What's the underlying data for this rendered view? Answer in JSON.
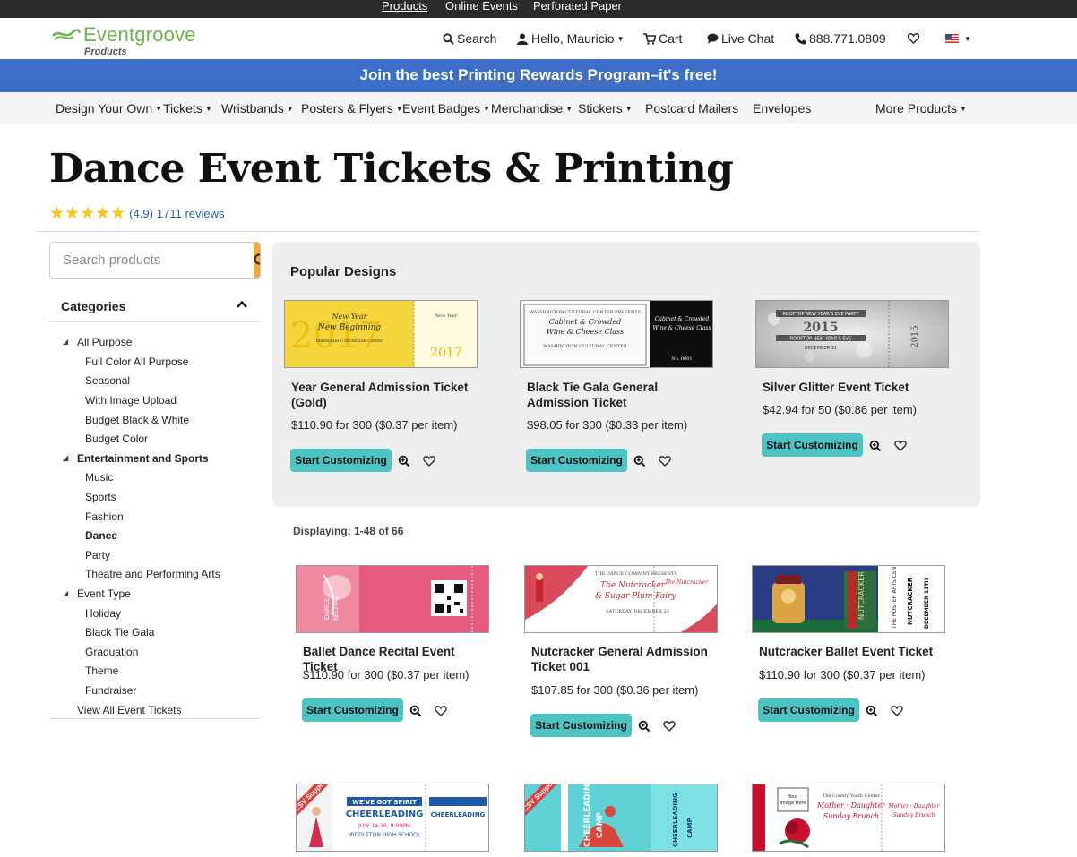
{
  "topbar": {
    "items": [
      "Products",
      "Online Events",
      "Perforated Paper"
    ]
  },
  "header": {
    "brand": "Eventgroove",
    "brand_sub": "Products",
    "search": "Search",
    "greeting": "Hello, Mauricio",
    "cart": "Cart",
    "chat": "Live Chat",
    "phone": "888.771.0809"
  },
  "promo": {
    "prefix": "Join the best ",
    "link": "Printing Rewards Program",
    "suffix": "–it's free!"
  },
  "mainnav": [
    "Design Your Own",
    "Tickets",
    "Wristbands",
    "Posters & Flyers",
    "Event Badges",
    "Merchandise",
    "Stickers",
    "Postcard Mailers",
    "Envelopes",
    "More Products"
  ],
  "page": {
    "title": "Dance Event Tickets & Printing",
    "rating_value": "(4.9)",
    "reviews": "1711 reviews",
    "stars": 5
  },
  "sidebar": {
    "search_placeholder": "Search products",
    "categories_label": "Categories",
    "groups": [
      {
        "label": "All Purpose",
        "items": [
          "Full Color All Purpose",
          "Seasonal",
          "With Image Upload",
          "Budget Black & White",
          "Budget Color"
        ]
      },
      {
        "label": "Entertainment and Sports",
        "items": [
          "Music",
          "Sports",
          "Fashion",
          "Dance",
          "Party",
          "Theatre and Performing Arts"
        ]
      },
      {
        "label": "Event Type",
        "items": [
          "Holiday",
          "Black Tie Gala",
          "Graduation",
          "Theme",
          "Fundraiser"
        ]
      }
    ],
    "view_all": "View All Event Tickets"
  },
  "popular": {
    "heading": "Popular Designs",
    "products": [
      {
        "name": "Year General Admission Ticket (Gold)",
        "price": "$110.90 for 300 ($0.37 per item)",
        "thumb_text": "New Year New Beginning",
        "thumb_year": "2017"
      },
      {
        "name": "Black Tie Gala General Admission Ticket",
        "price": "$98.05 for 300 ($0.33 per item)",
        "thumb_text": "Cabinet & Crowded Wine & Cheese Class"
      },
      {
        "name": "Silver Glitter Event Ticket",
        "price": "$42.94 for 50 ($0.86 per item)",
        "thumb_text": "2015",
        "thumb_sub": "ROOFTOP NEW YEAR'S EVE"
      }
    ]
  },
  "listing": {
    "displaying": "Displaying: 1-48 of 66",
    "products": [
      {
        "name": "Ballet Dance Recital Event Ticket",
        "price": "$110.90 for 300 ($0.37 per item)",
        "thumb_text": "DANCE RECITAL"
      },
      {
        "name": "Nutcracker General Admission Ticket 001",
        "price": "$107.85 for 300 ($0.36 per item)",
        "thumb_text": "The Nutcracker & Sugar Plum Fairy"
      },
      {
        "name": "Nutcracker Ballet Event Ticket",
        "price": "$110.90 for 300 ($0.37 per item)",
        "thumb_text": "NUTCRACKER"
      }
    ],
    "row3": [
      {
        "thumb_text": "CHEERLEADING",
        "sub": "WE'VE GOT SPIRIT",
        "badge": "CSV Support"
      },
      {
        "thumb_text": "CHEERLEADING CAMP",
        "badge": "CSV Support"
      },
      {
        "thumb_text": "Mother Daughter Sunday Brunch",
        "sub": "Your Image Here"
      }
    ]
  },
  "common": {
    "cta": "Start Customizing"
  },
  "colors": {
    "accent": "#4cc4c4",
    "promo": "#3d6fc9",
    "brand": "#6bb34a",
    "search_btn": "#f0a93c"
  }
}
